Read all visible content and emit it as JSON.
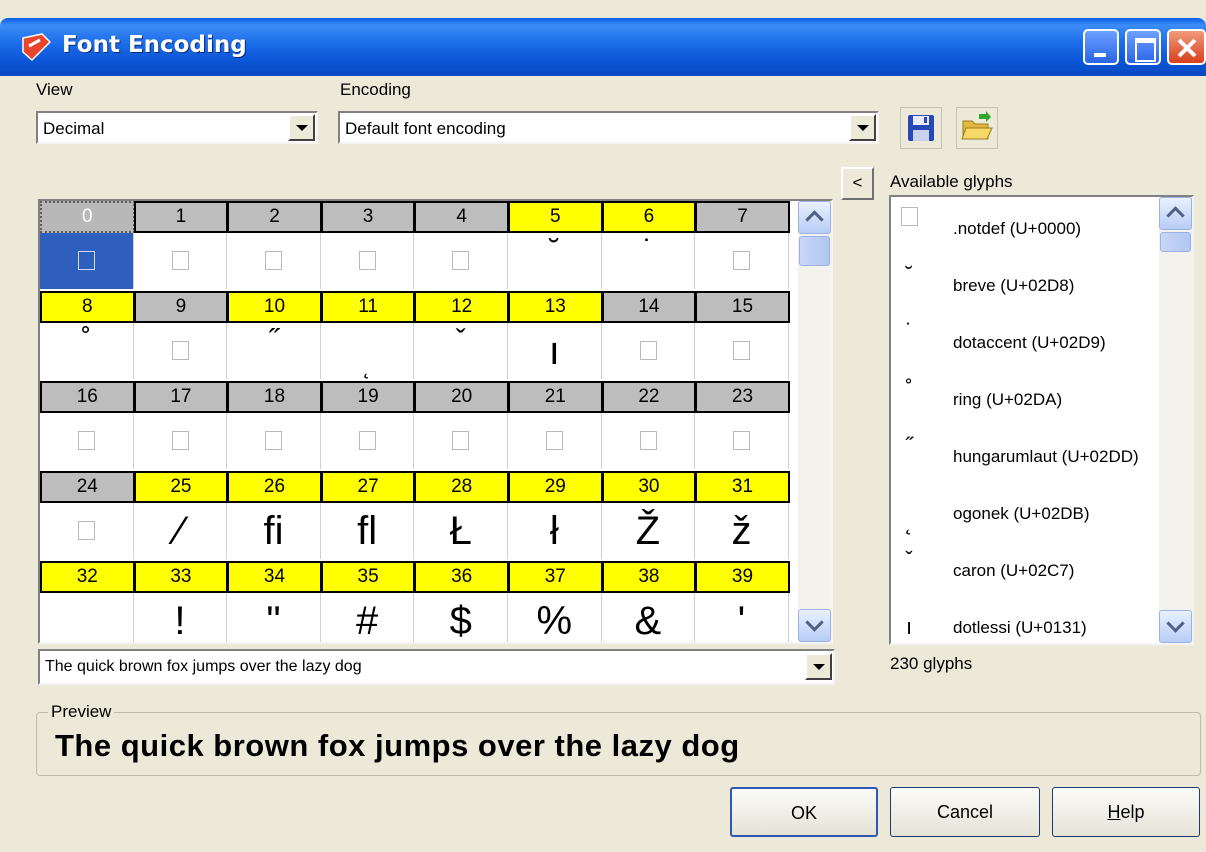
{
  "window": {
    "title": "Font Encoding"
  },
  "view": {
    "label": "View",
    "value": "Decimal"
  },
  "encoding": {
    "label": "Encoding",
    "value": "Default font encoding"
  },
  "toolbar": {
    "collapse_label": "<"
  },
  "grid": {
    "rows": [
      {
        "codes": [
          "0",
          "1",
          "2",
          "3",
          "4",
          "5",
          "6",
          "7"
        ],
        "headers": [
          "g",
          "g",
          "g",
          "g",
          "g",
          "y",
          "y",
          "g"
        ],
        "glyphs": [
          "□",
          "□",
          "□",
          "□",
          "□",
          "˘",
          "˙",
          "□"
        ]
      },
      {
        "codes": [
          "8",
          "9",
          "10",
          "11",
          "12",
          "13",
          "14",
          "15"
        ],
        "headers": [
          "y",
          "g",
          "y",
          "y",
          "y",
          "y",
          "g",
          "g"
        ],
        "glyphs": [
          "˚",
          "□",
          "˝",
          "˛",
          "ˇ",
          "ı",
          "□",
          "□"
        ]
      },
      {
        "codes": [
          "16",
          "17",
          "18",
          "19",
          "20",
          "21",
          "22",
          "23"
        ],
        "headers": [
          "g",
          "g",
          "g",
          "g",
          "g",
          "g",
          "g",
          "g"
        ],
        "glyphs": [
          "□",
          "□",
          "□",
          "□",
          "□",
          "□",
          "□",
          "□"
        ]
      },
      {
        "codes": [
          "24",
          "25",
          "26",
          "27",
          "28",
          "29",
          "30",
          "31"
        ],
        "headers": [
          "g",
          "y",
          "y",
          "y",
          "y",
          "y",
          "y",
          "y"
        ],
        "glyphs": [
          "□",
          "⁄",
          "fi",
          "fl",
          "Ł",
          "ł",
          "Ž",
          "ž"
        ]
      },
      {
        "codes": [
          "32",
          "33",
          "34",
          "35",
          "36",
          "37",
          "38",
          "39"
        ],
        "headers": [
          "y",
          "y",
          "y",
          "y",
          "y",
          "y",
          "y",
          "y"
        ],
        "glyphs": [
          " ",
          "!",
          "\"",
          "#",
          "$",
          "%",
          "&",
          "'"
        ]
      }
    ],
    "selected_code": "0"
  },
  "glyphs_panel": {
    "label": "Available glyphs",
    "items": [
      {
        "symbol": "□",
        "name": ".notdef (U+0000)"
      },
      {
        "symbol": "˘",
        "name": "breve (U+02D8)"
      },
      {
        "symbol": "˙",
        "name": "dotaccent (U+02D9)"
      },
      {
        "symbol": "˚",
        "name": "ring (U+02DA)"
      },
      {
        "symbol": "˝",
        "name": "hungarumlaut (U+02DD)"
      },
      {
        "symbol": "˛",
        "name": "ogonek (U+02DB)"
      },
      {
        "symbol": "ˇ",
        "name": "caron (U+02C7)"
      },
      {
        "symbol": "ı",
        "name": "dotlessi (U+0131)"
      }
    ],
    "count": "230 glyphs"
  },
  "sample": {
    "value": "The quick brown fox jumps over the lazy dog"
  },
  "preview": {
    "label": "Preview",
    "text": "The quick brown fox jumps over the lazy dog"
  },
  "buttons": {
    "ok": "OK",
    "cancel": "Cancel",
    "help_rest": "elp",
    "help_accel": "H"
  }
}
